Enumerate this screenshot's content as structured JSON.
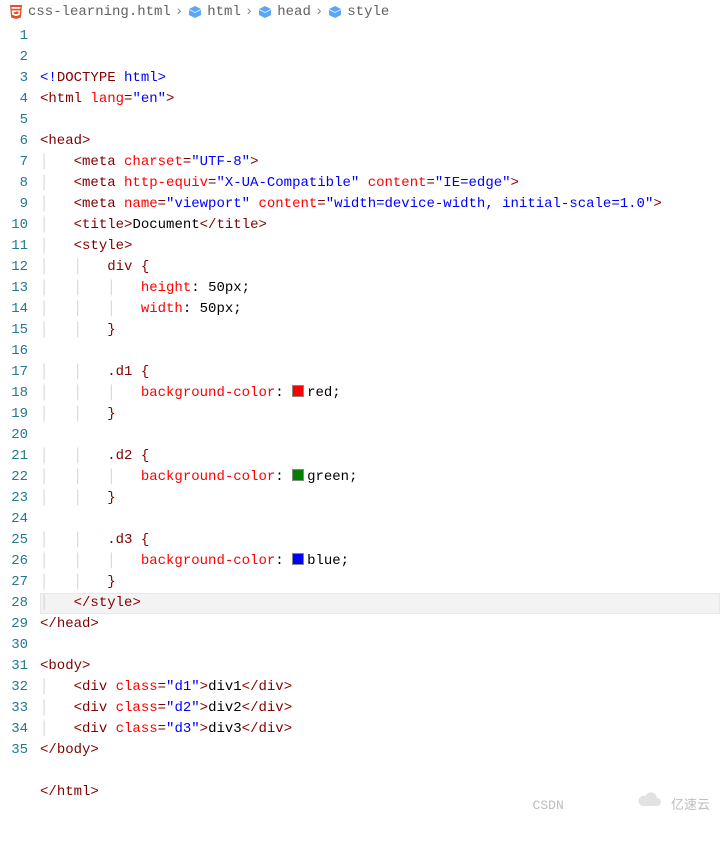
{
  "breadcrumb": {
    "file": "css-learning.html",
    "items": [
      "html",
      "head",
      "style"
    ]
  },
  "watermark": {
    "csdn": "CSDN",
    "yisu": "亿速云"
  },
  "code": {
    "lines": [
      {
        "n": 1,
        "i": 0,
        "tok": [
          [
            "doctype",
            "<!"
          ],
          [
            "doctype-keyword",
            "DOCTYPE"
          ],
          [
            "doctype",
            " html>"
          ]
        ]
      },
      {
        "n": 2,
        "i": 0,
        "tok": [
          [
            "tag-angle",
            "<"
          ],
          [
            "tag",
            "html "
          ],
          [
            "attr-name",
            "lang"
          ],
          [
            "tag",
            "="
          ],
          [
            "attr-value",
            "\"en\""
          ],
          [
            "tag-angle",
            ">"
          ]
        ]
      },
      {
        "n": 3,
        "i": 0,
        "tok": []
      },
      {
        "n": 4,
        "i": 0,
        "tok": [
          [
            "tag-angle",
            "<"
          ],
          [
            "tag",
            "head"
          ],
          [
            "tag-angle",
            ">"
          ]
        ]
      },
      {
        "n": 5,
        "i": 1,
        "tok": [
          [
            "tag-angle",
            "<"
          ],
          [
            "tag",
            "meta "
          ],
          [
            "attr-name",
            "charset"
          ],
          [
            "tag",
            "="
          ],
          [
            "attr-value",
            "\"UTF-8\""
          ],
          [
            "tag-angle",
            ">"
          ]
        ]
      },
      {
        "n": 6,
        "i": 1,
        "tok": [
          [
            "tag-angle",
            "<"
          ],
          [
            "tag",
            "meta "
          ],
          [
            "attr-name",
            "http-equiv"
          ],
          [
            "tag",
            "="
          ],
          [
            "attr-value",
            "\"X-UA-Compatible\""
          ],
          [
            "tag",
            " "
          ],
          [
            "attr-name",
            "content"
          ],
          [
            "tag",
            "="
          ],
          [
            "attr-value",
            "\"IE=edge\""
          ],
          [
            "tag-angle",
            ">"
          ]
        ]
      },
      {
        "n": 7,
        "i": 1,
        "tok": [
          [
            "tag-angle",
            "<"
          ],
          [
            "tag",
            "meta "
          ],
          [
            "attr-name",
            "name"
          ],
          [
            "tag",
            "="
          ],
          [
            "attr-value",
            "\"viewport\""
          ],
          [
            "tag",
            " "
          ],
          [
            "attr-name",
            "content"
          ],
          [
            "tag",
            "="
          ],
          [
            "attr-value",
            "\"width=device-width, initial-scale=1.0\""
          ],
          [
            "tag-angle",
            ">"
          ]
        ]
      },
      {
        "n": 8,
        "i": 1,
        "tok": [
          [
            "tag-angle",
            "<"
          ],
          [
            "tag",
            "title"
          ],
          [
            "tag-angle",
            ">"
          ],
          [
            "text-content",
            "Document"
          ],
          [
            "tag-angle",
            "</"
          ],
          [
            "tag",
            "title"
          ],
          [
            "tag-angle",
            ">"
          ]
        ]
      },
      {
        "n": 9,
        "i": 1,
        "tok": [
          [
            "tag-angle",
            "<"
          ],
          [
            "tag",
            "style"
          ],
          [
            "tag-angle",
            ">"
          ]
        ]
      },
      {
        "n": 10,
        "i": 2,
        "tok": [
          [
            "css-selector",
            "div "
          ],
          [
            "css-brace",
            "{"
          ]
        ]
      },
      {
        "n": 11,
        "i": 3,
        "tok": [
          [
            "css-prop",
            "height"
          ],
          [
            "css-punct",
            ": "
          ],
          [
            "css-val",
            "50px"
          ],
          [
            "css-punct",
            ";"
          ]
        ]
      },
      {
        "n": 12,
        "i": 3,
        "tok": [
          [
            "css-prop",
            "width"
          ],
          [
            "css-punct",
            ": "
          ],
          [
            "css-val",
            "50px"
          ],
          [
            "css-punct",
            ";"
          ]
        ]
      },
      {
        "n": 13,
        "i": 2,
        "tok": [
          [
            "css-brace",
            "}"
          ]
        ]
      },
      {
        "n": 14,
        "i": 0,
        "tok": []
      },
      {
        "n": 15,
        "i": 2,
        "tok": [
          [
            "css-selector",
            ".d1 "
          ],
          [
            "css-brace",
            "{"
          ]
        ]
      },
      {
        "n": 16,
        "i": 3,
        "tok": [
          [
            "css-prop",
            "background-color"
          ],
          [
            "css-punct",
            ": "
          ],
          [
            "swatch",
            "#ff0000"
          ],
          [
            "css-val",
            "red"
          ],
          [
            "css-punct",
            ";"
          ]
        ]
      },
      {
        "n": 17,
        "i": 2,
        "tok": [
          [
            "css-brace",
            "}"
          ]
        ]
      },
      {
        "n": 18,
        "i": 0,
        "tok": []
      },
      {
        "n": 19,
        "i": 2,
        "tok": [
          [
            "css-selector",
            ".d2 "
          ],
          [
            "css-brace",
            "{"
          ]
        ]
      },
      {
        "n": 20,
        "i": 3,
        "tok": [
          [
            "css-prop",
            "background-color"
          ],
          [
            "css-punct",
            ": "
          ],
          [
            "swatch",
            "#008000"
          ],
          [
            "css-val",
            "green"
          ],
          [
            "css-punct",
            ";"
          ]
        ]
      },
      {
        "n": 21,
        "i": 2,
        "tok": [
          [
            "css-brace",
            "}"
          ]
        ]
      },
      {
        "n": 22,
        "i": 0,
        "tok": []
      },
      {
        "n": 23,
        "i": 2,
        "tok": [
          [
            "css-selector",
            ".d3 "
          ],
          [
            "css-brace",
            "{"
          ]
        ]
      },
      {
        "n": 24,
        "i": 3,
        "tok": [
          [
            "css-prop",
            "background-color"
          ],
          [
            "css-punct",
            ": "
          ],
          [
            "swatch",
            "#0000ff"
          ],
          [
            "css-val",
            "blue"
          ],
          [
            "css-punct",
            ";"
          ]
        ]
      },
      {
        "n": 25,
        "i": 2,
        "tok": [
          [
            "css-brace",
            "}"
          ]
        ]
      },
      {
        "n": 26,
        "i": 1,
        "hl": true,
        "tok": [
          [
            "tag-angle",
            "</"
          ],
          [
            "tag",
            "style"
          ],
          [
            "tag-angle",
            ">"
          ]
        ]
      },
      {
        "n": 27,
        "i": 0,
        "tok": [
          [
            "tag-angle",
            "</"
          ],
          [
            "tag",
            "head"
          ],
          [
            "tag-angle",
            ">"
          ]
        ]
      },
      {
        "n": 28,
        "i": 0,
        "tok": []
      },
      {
        "n": 29,
        "i": 0,
        "tok": [
          [
            "tag-angle",
            "<"
          ],
          [
            "tag",
            "body"
          ],
          [
            "tag-angle",
            ">"
          ]
        ]
      },
      {
        "n": 30,
        "i": 1,
        "tok": [
          [
            "tag-angle",
            "<"
          ],
          [
            "tag",
            "div "
          ],
          [
            "attr-name",
            "class"
          ],
          [
            "tag",
            "="
          ],
          [
            "attr-value",
            "\"d1\""
          ],
          [
            "tag-angle",
            ">"
          ],
          [
            "text-content",
            "div1"
          ],
          [
            "tag-angle",
            "</"
          ],
          [
            "tag",
            "div"
          ],
          [
            "tag-angle",
            ">"
          ]
        ]
      },
      {
        "n": 31,
        "i": 1,
        "tok": [
          [
            "tag-angle",
            "<"
          ],
          [
            "tag",
            "div "
          ],
          [
            "attr-name",
            "class"
          ],
          [
            "tag",
            "="
          ],
          [
            "attr-value",
            "\"d2\""
          ],
          [
            "tag-angle",
            ">"
          ],
          [
            "text-content",
            "div2"
          ],
          [
            "tag-angle",
            "</"
          ],
          [
            "tag",
            "div"
          ],
          [
            "tag-angle",
            ">"
          ]
        ]
      },
      {
        "n": 32,
        "i": 1,
        "tok": [
          [
            "tag-angle",
            "<"
          ],
          [
            "tag",
            "div "
          ],
          [
            "attr-name",
            "class"
          ],
          [
            "tag",
            "="
          ],
          [
            "attr-value",
            "\"d3\""
          ],
          [
            "tag-angle",
            ">"
          ],
          [
            "text-content",
            "div3"
          ],
          [
            "tag-angle",
            "</"
          ],
          [
            "tag",
            "div"
          ],
          [
            "tag-angle",
            ">"
          ]
        ]
      },
      {
        "n": 33,
        "i": 0,
        "tok": [
          [
            "tag-angle",
            "</"
          ],
          [
            "tag",
            "body"
          ],
          [
            "tag-angle",
            ">"
          ]
        ]
      },
      {
        "n": 34,
        "i": 0,
        "tok": []
      },
      {
        "n": 35,
        "i": 0,
        "tok": [
          [
            "tag-angle",
            "</"
          ],
          [
            "tag",
            "html"
          ],
          [
            "tag-angle",
            ">"
          ]
        ]
      }
    ]
  }
}
